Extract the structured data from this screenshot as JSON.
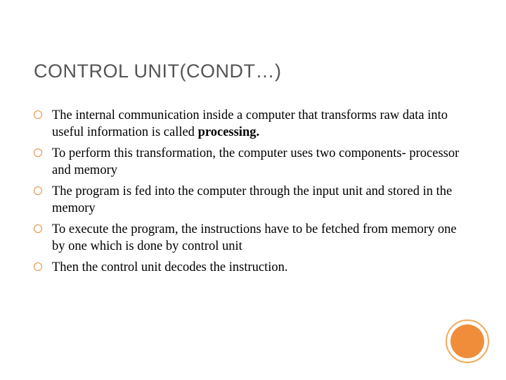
{
  "title": "CONTROL UNIT(CONDT…)",
  "bullets": [
    {
      "pre": "The internal communication inside a computer that transforms raw data into useful information is called ",
      "bold": "processing.",
      "post": ""
    },
    {
      "pre": "To perform this transformation, the computer uses two components- processor and memory",
      "bold": "",
      "post": ""
    },
    {
      "pre": "The program is fed into the computer through the input unit and stored in the memory",
      "bold": "",
      "post": ""
    },
    {
      "pre": "To execute the program, the instructions have to be fetched from memory one by one which is done by control unit",
      "bold": "",
      "post": ""
    },
    {
      "pre": "Then the control unit decodes the instruction.",
      "bold": "",
      "post": ""
    }
  ]
}
